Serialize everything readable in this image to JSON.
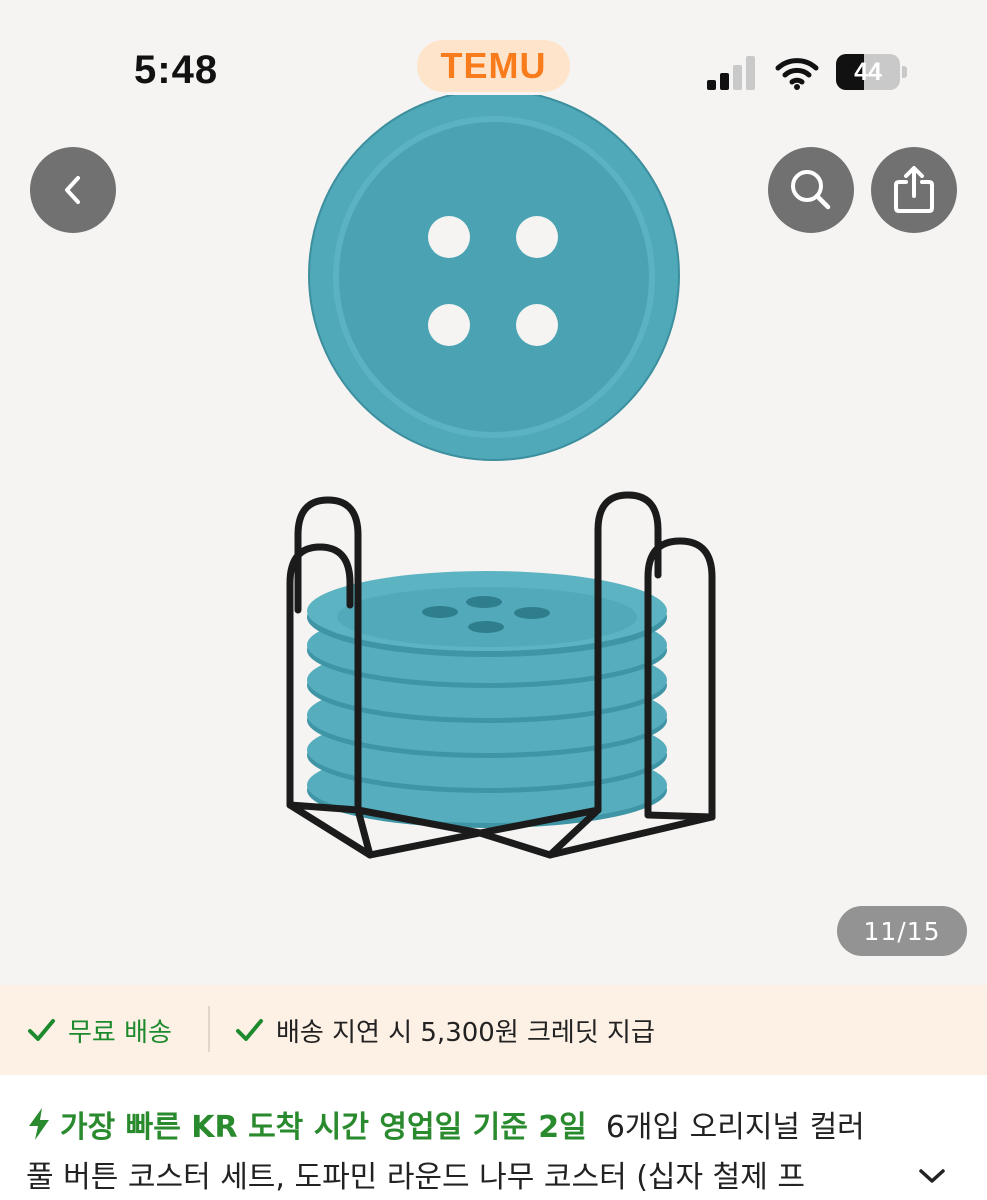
{
  "status_bar": {
    "time": "5:48",
    "battery_level": 44
  },
  "brand": {
    "name": "TEMU",
    "color": "#f87b1c"
  },
  "icons": {
    "back": "chevron-left-icon",
    "search": "search-icon",
    "share": "share-icon",
    "expand": "chevron-down-icon"
  },
  "gallery": {
    "counter": "11/15"
  },
  "shipping": {
    "free": "무료 배송",
    "delay_credit": "배송 지연 시 5,300원 크레딧 지급",
    "accent": "#1e8a2e"
  },
  "product": {
    "fast_arrival": "가장 빠른 KR 도착 시간 영업일 기준 2일",
    "title_part1": "6개입 오리지널 컬러",
    "title_part2": "풀 버튼 코스터 세트, 도파민 라운드 나무 코스터 (십자 철제 프"
  }
}
